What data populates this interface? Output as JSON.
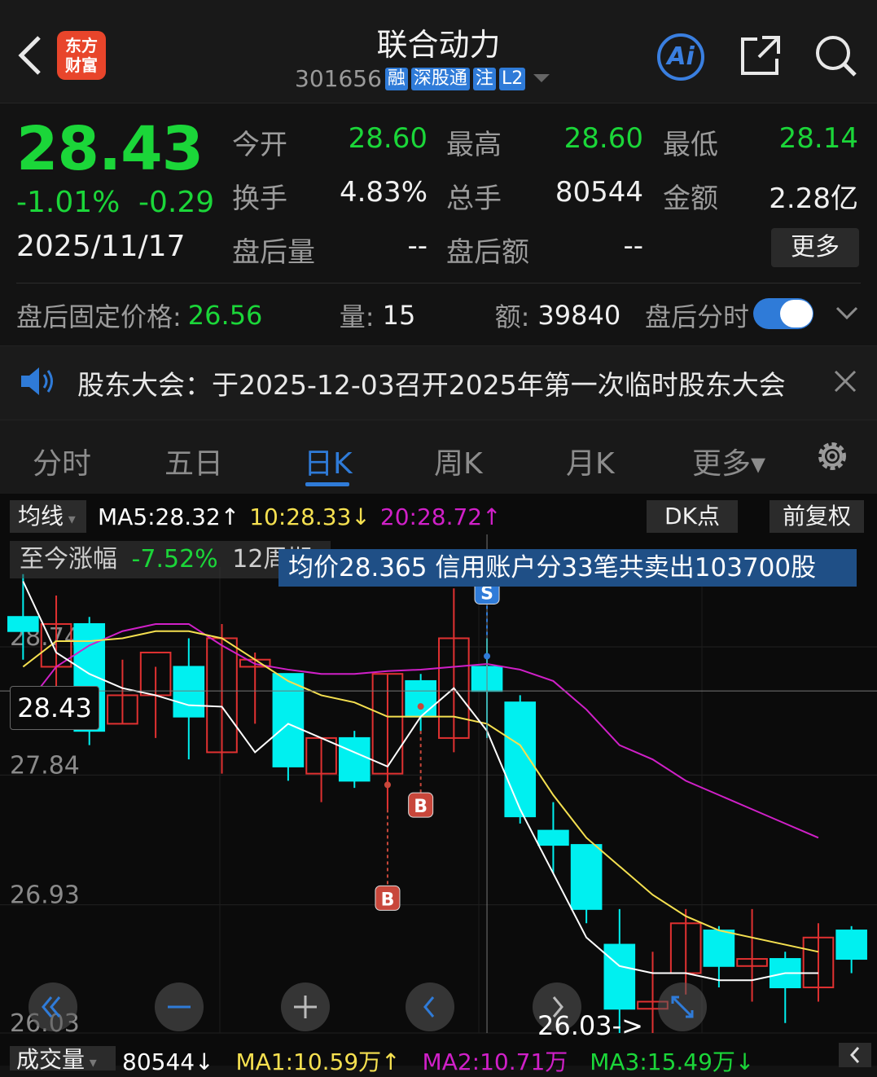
{
  "header": {
    "title": "联合动力",
    "code": "301656",
    "tags": [
      "融",
      "深股通",
      "注",
      "L2"
    ],
    "logo_line1": "东方",
    "logo_line2": "财富",
    "ai_label": "Ai"
  },
  "quote": {
    "price": "28.43",
    "change_pct": "-1.01%",
    "change": "-0.29",
    "date": "2025/11/17",
    "fields": [
      {
        "label": "今开",
        "value": "28.60",
        "tone": "green"
      },
      {
        "label": "最高",
        "value": "28.60",
        "tone": "green"
      },
      {
        "label": "最低",
        "value": "28.14",
        "tone": "green"
      },
      {
        "label": "换手",
        "value": "4.83%",
        "tone": "white"
      },
      {
        "label": "总手",
        "value": "80544",
        "tone": "white"
      },
      {
        "label": "金额",
        "value": "2.28亿",
        "tone": "white"
      },
      {
        "label": "盘后量",
        "value": "--",
        "tone": "white"
      },
      {
        "label": "盘后额",
        "value": "--",
        "tone": "white"
      }
    ],
    "more_label": "更多"
  },
  "after_hours": {
    "fixed_price_label": "盘后固定价格:",
    "fixed_price": "26.56",
    "volume_label": "量:",
    "volume": "15",
    "amount_label": "额:",
    "amount": "39840",
    "toggle_label": "盘后分时",
    "toggle_on": true
  },
  "notice": {
    "text": "股东大会：于2025-12-03召开2025年第一次临时股东大会"
  },
  "tabs": [
    {
      "label": "分时",
      "active": false
    },
    {
      "label": "五日",
      "active": false
    },
    {
      "label": "日K",
      "active": true
    },
    {
      "label": "周K",
      "active": false
    },
    {
      "label": "月K",
      "active": false
    },
    {
      "label": "更多▾",
      "active": false
    }
  ],
  "chart_header": {
    "ma_selector": "均线",
    "ma5": "MA5:28.32↑",
    "ma10": "10:28.33↓",
    "ma20": "20:28.72↑",
    "dk_button": "DK点",
    "adjust_button": "前复权",
    "perf_label": "至今涨幅",
    "perf_value": "-7.52%",
    "perf_period": "12周期",
    "tooltip": "均价28.365  信用账户分33笔共卖出103700股",
    "current_price_box": "28.43",
    "min_label": "26.03->",
    "colors": {
      "up": "#e03131",
      "down": "#00f0f0",
      "ma5": "#ffffff",
      "ma10": "#f5e050",
      "ma20": "#d020c8",
      "accent": "#2f7bd8"
    }
  },
  "chart_data": {
    "type": "candlestick",
    "y_ticks": [
      "28.74",
      "27.84",
      "26.93",
      "26.03"
    ],
    "ylim": [
      26.03,
      29.3
    ],
    "candles": [
      {
        "o": 28.95,
        "h": 29.25,
        "l": 28.65,
        "c": 28.85
      },
      {
        "o": 28.6,
        "h": 29.1,
        "l": 28.4,
        "c": 28.9
      },
      {
        "o": 28.9,
        "h": 28.95,
        "l": 28.05,
        "c": 28.15
      },
      {
        "o": 28.2,
        "h": 28.65,
        "l": 28.2,
        "c": 28.4
      },
      {
        "o": 28.4,
        "h": 28.6,
        "l": 28.1,
        "c": 28.7
      },
      {
        "o": 28.6,
        "h": 28.8,
        "l": 27.95,
        "c": 28.25
      },
      {
        "o": 28.0,
        "h": 28.9,
        "l": 27.85,
        "c": 28.8
      },
      {
        "o": 28.6,
        "h": 28.7,
        "l": 28.2,
        "c": 28.65
      },
      {
        "o": 28.55,
        "h": 28.55,
        "l": 27.8,
        "c": 27.9
      },
      {
        "o": 27.85,
        "h": 28.1,
        "l": 27.65,
        "c": 28.1
      },
      {
        "o": 28.1,
        "h": 28.15,
        "l": 27.75,
        "c": 27.8
      },
      {
        "o": 27.85,
        "h": 28.55,
        "l": 27.6,
        "c": 28.55
      },
      {
        "o": 28.5,
        "h": 28.55,
        "l": 28.15,
        "c": 28.25
      },
      {
        "o": 28.1,
        "h": 29.15,
        "l": 28.0,
        "c": 28.8
      },
      {
        "o": 28.6,
        "h": 28.8,
        "l": 28.1,
        "c": 28.43
      },
      {
        "o": 28.35,
        "h": 28.4,
        "l": 27.5,
        "c": 27.55
      },
      {
        "o": 27.45,
        "h": 27.65,
        "l": 27.15,
        "c": 27.35
      },
      {
        "o": 27.35,
        "h": 27.35,
        "l": 26.8,
        "c": 26.9
      },
      {
        "o": 26.65,
        "h": 26.9,
        "l": 26.03,
        "c": 26.2
      },
      {
        "o": 26.2,
        "h": 26.6,
        "l": 26.03,
        "c": 26.25
      },
      {
        "o": 26.45,
        "h": 26.9,
        "l": 26.3,
        "c": 26.8
      },
      {
        "o": 26.75,
        "h": 26.78,
        "l": 26.35,
        "c": 26.5
      },
      {
        "o": 26.5,
        "h": 26.9,
        "l": 26.25,
        "c": 26.55
      },
      {
        "o": 26.55,
        "h": 26.6,
        "l": 26.1,
        "c": 26.35
      },
      {
        "o": 26.35,
        "h": 26.8,
        "l": 26.25,
        "c": 26.7
      },
      {
        "o": 26.75,
        "h": 26.78,
        "l": 26.45,
        "c": 26.55
      }
    ],
    "ma5": [
      29.2,
      28.7,
      28.55,
      28.45,
      28.4,
      28.33,
      28.32,
      28.0,
      28.2,
      28.1,
      28.0,
      27.9,
      28.25,
      28.45,
      28.15,
      27.6,
      27.15,
      26.7,
      26.5,
      26.45,
      26.45,
      26.4,
      26.4,
      26.45,
      26.45
    ],
    "ma10": [
      28.6,
      28.78,
      28.78,
      28.8,
      28.85,
      28.85,
      28.8,
      28.65,
      28.5,
      28.4,
      28.35,
      28.25,
      28.25,
      28.25,
      28.2,
      28.05,
      27.7,
      27.4,
      27.2,
      27.0,
      26.85,
      26.75,
      26.7,
      26.65,
      26.6
    ],
    "ma20": [
      28.3,
      28.6,
      28.75,
      28.85,
      28.9,
      28.9,
      28.75,
      28.62,
      28.58,
      28.55,
      28.55,
      28.57,
      28.58,
      28.6,
      28.62,
      28.58,
      28.5,
      28.3,
      28.05,
      27.95,
      27.8,
      27.7,
      27.6,
      27.5,
      27.4
    ],
    "markers": [
      {
        "index": 11,
        "label": "B"
      },
      {
        "index": 12,
        "label": "B"
      },
      {
        "index": 14,
        "label": "S"
      }
    ]
  },
  "volume_header": {
    "selector": "成交量",
    "total": "80544↓",
    "ma1": "MA1:10.59万↑",
    "ma2": "MA2:10.71万",
    "ma3": "MA3:15.49万↓"
  }
}
